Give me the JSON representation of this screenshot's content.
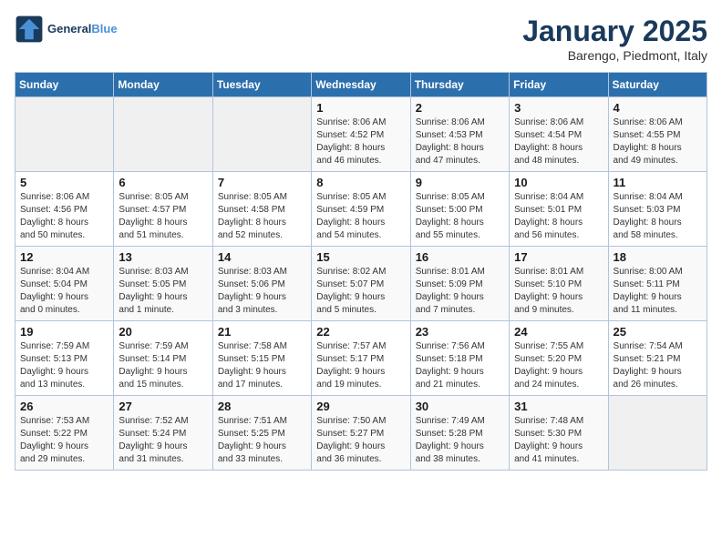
{
  "logo": {
    "text_general": "General",
    "text_blue": "Blue"
  },
  "header": {
    "month_title": "January 2025",
    "location": "Barengo, Piedmont, Italy"
  },
  "weekdays": [
    "Sunday",
    "Monday",
    "Tuesday",
    "Wednesday",
    "Thursday",
    "Friday",
    "Saturday"
  ],
  "weeks": [
    [
      {
        "day": null,
        "info": null
      },
      {
        "day": null,
        "info": null
      },
      {
        "day": null,
        "info": null
      },
      {
        "day": "1",
        "info": "Sunrise: 8:06 AM\nSunset: 4:52 PM\nDaylight: 8 hours\nand 46 minutes."
      },
      {
        "day": "2",
        "info": "Sunrise: 8:06 AM\nSunset: 4:53 PM\nDaylight: 8 hours\nand 47 minutes."
      },
      {
        "day": "3",
        "info": "Sunrise: 8:06 AM\nSunset: 4:54 PM\nDaylight: 8 hours\nand 48 minutes."
      },
      {
        "day": "4",
        "info": "Sunrise: 8:06 AM\nSunset: 4:55 PM\nDaylight: 8 hours\nand 49 minutes."
      }
    ],
    [
      {
        "day": "5",
        "info": "Sunrise: 8:06 AM\nSunset: 4:56 PM\nDaylight: 8 hours\nand 50 minutes."
      },
      {
        "day": "6",
        "info": "Sunrise: 8:05 AM\nSunset: 4:57 PM\nDaylight: 8 hours\nand 51 minutes."
      },
      {
        "day": "7",
        "info": "Sunrise: 8:05 AM\nSunset: 4:58 PM\nDaylight: 8 hours\nand 52 minutes."
      },
      {
        "day": "8",
        "info": "Sunrise: 8:05 AM\nSunset: 4:59 PM\nDaylight: 8 hours\nand 54 minutes."
      },
      {
        "day": "9",
        "info": "Sunrise: 8:05 AM\nSunset: 5:00 PM\nDaylight: 8 hours\nand 55 minutes."
      },
      {
        "day": "10",
        "info": "Sunrise: 8:04 AM\nSunset: 5:01 PM\nDaylight: 8 hours\nand 56 minutes."
      },
      {
        "day": "11",
        "info": "Sunrise: 8:04 AM\nSunset: 5:03 PM\nDaylight: 8 hours\nand 58 minutes."
      }
    ],
    [
      {
        "day": "12",
        "info": "Sunrise: 8:04 AM\nSunset: 5:04 PM\nDaylight: 9 hours\nand 0 minutes."
      },
      {
        "day": "13",
        "info": "Sunrise: 8:03 AM\nSunset: 5:05 PM\nDaylight: 9 hours\nand 1 minute."
      },
      {
        "day": "14",
        "info": "Sunrise: 8:03 AM\nSunset: 5:06 PM\nDaylight: 9 hours\nand 3 minutes."
      },
      {
        "day": "15",
        "info": "Sunrise: 8:02 AM\nSunset: 5:07 PM\nDaylight: 9 hours\nand 5 minutes."
      },
      {
        "day": "16",
        "info": "Sunrise: 8:01 AM\nSunset: 5:09 PM\nDaylight: 9 hours\nand 7 minutes."
      },
      {
        "day": "17",
        "info": "Sunrise: 8:01 AM\nSunset: 5:10 PM\nDaylight: 9 hours\nand 9 minutes."
      },
      {
        "day": "18",
        "info": "Sunrise: 8:00 AM\nSunset: 5:11 PM\nDaylight: 9 hours\nand 11 minutes."
      }
    ],
    [
      {
        "day": "19",
        "info": "Sunrise: 7:59 AM\nSunset: 5:13 PM\nDaylight: 9 hours\nand 13 minutes."
      },
      {
        "day": "20",
        "info": "Sunrise: 7:59 AM\nSunset: 5:14 PM\nDaylight: 9 hours\nand 15 minutes."
      },
      {
        "day": "21",
        "info": "Sunrise: 7:58 AM\nSunset: 5:15 PM\nDaylight: 9 hours\nand 17 minutes."
      },
      {
        "day": "22",
        "info": "Sunrise: 7:57 AM\nSunset: 5:17 PM\nDaylight: 9 hours\nand 19 minutes."
      },
      {
        "day": "23",
        "info": "Sunrise: 7:56 AM\nSunset: 5:18 PM\nDaylight: 9 hours\nand 21 minutes."
      },
      {
        "day": "24",
        "info": "Sunrise: 7:55 AM\nSunset: 5:20 PM\nDaylight: 9 hours\nand 24 minutes."
      },
      {
        "day": "25",
        "info": "Sunrise: 7:54 AM\nSunset: 5:21 PM\nDaylight: 9 hours\nand 26 minutes."
      }
    ],
    [
      {
        "day": "26",
        "info": "Sunrise: 7:53 AM\nSunset: 5:22 PM\nDaylight: 9 hours\nand 29 minutes."
      },
      {
        "day": "27",
        "info": "Sunrise: 7:52 AM\nSunset: 5:24 PM\nDaylight: 9 hours\nand 31 minutes."
      },
      {
        "day": "28",
        "info": "Sunrise: 7:51 AM\nSunset: 5:25 PM\nDaylight: 9 hours\nand 33 minutes."
      },
      {
        "day": "29",
        "info": "Sunrise: 7:50 AM\nSunset: 5:27 PM\nDaylight: 9 hours\nand 36 minutes."
      },
      {
        "day": "30",
        "info": "Sunrise: 7:49 AM\nSunset: 5:28 PM\nDaylight: 9 hours\nand 38 minutes."
      },
      {
        "day": "31",
        "info": "Sunrise: 7:48 AM\nSunset: 5:30 PM\nDaylight: 9 hours\nand 41 minutes."
      },
      {
        "day": null,
        "info": null
      }
    ]
  ]
}
